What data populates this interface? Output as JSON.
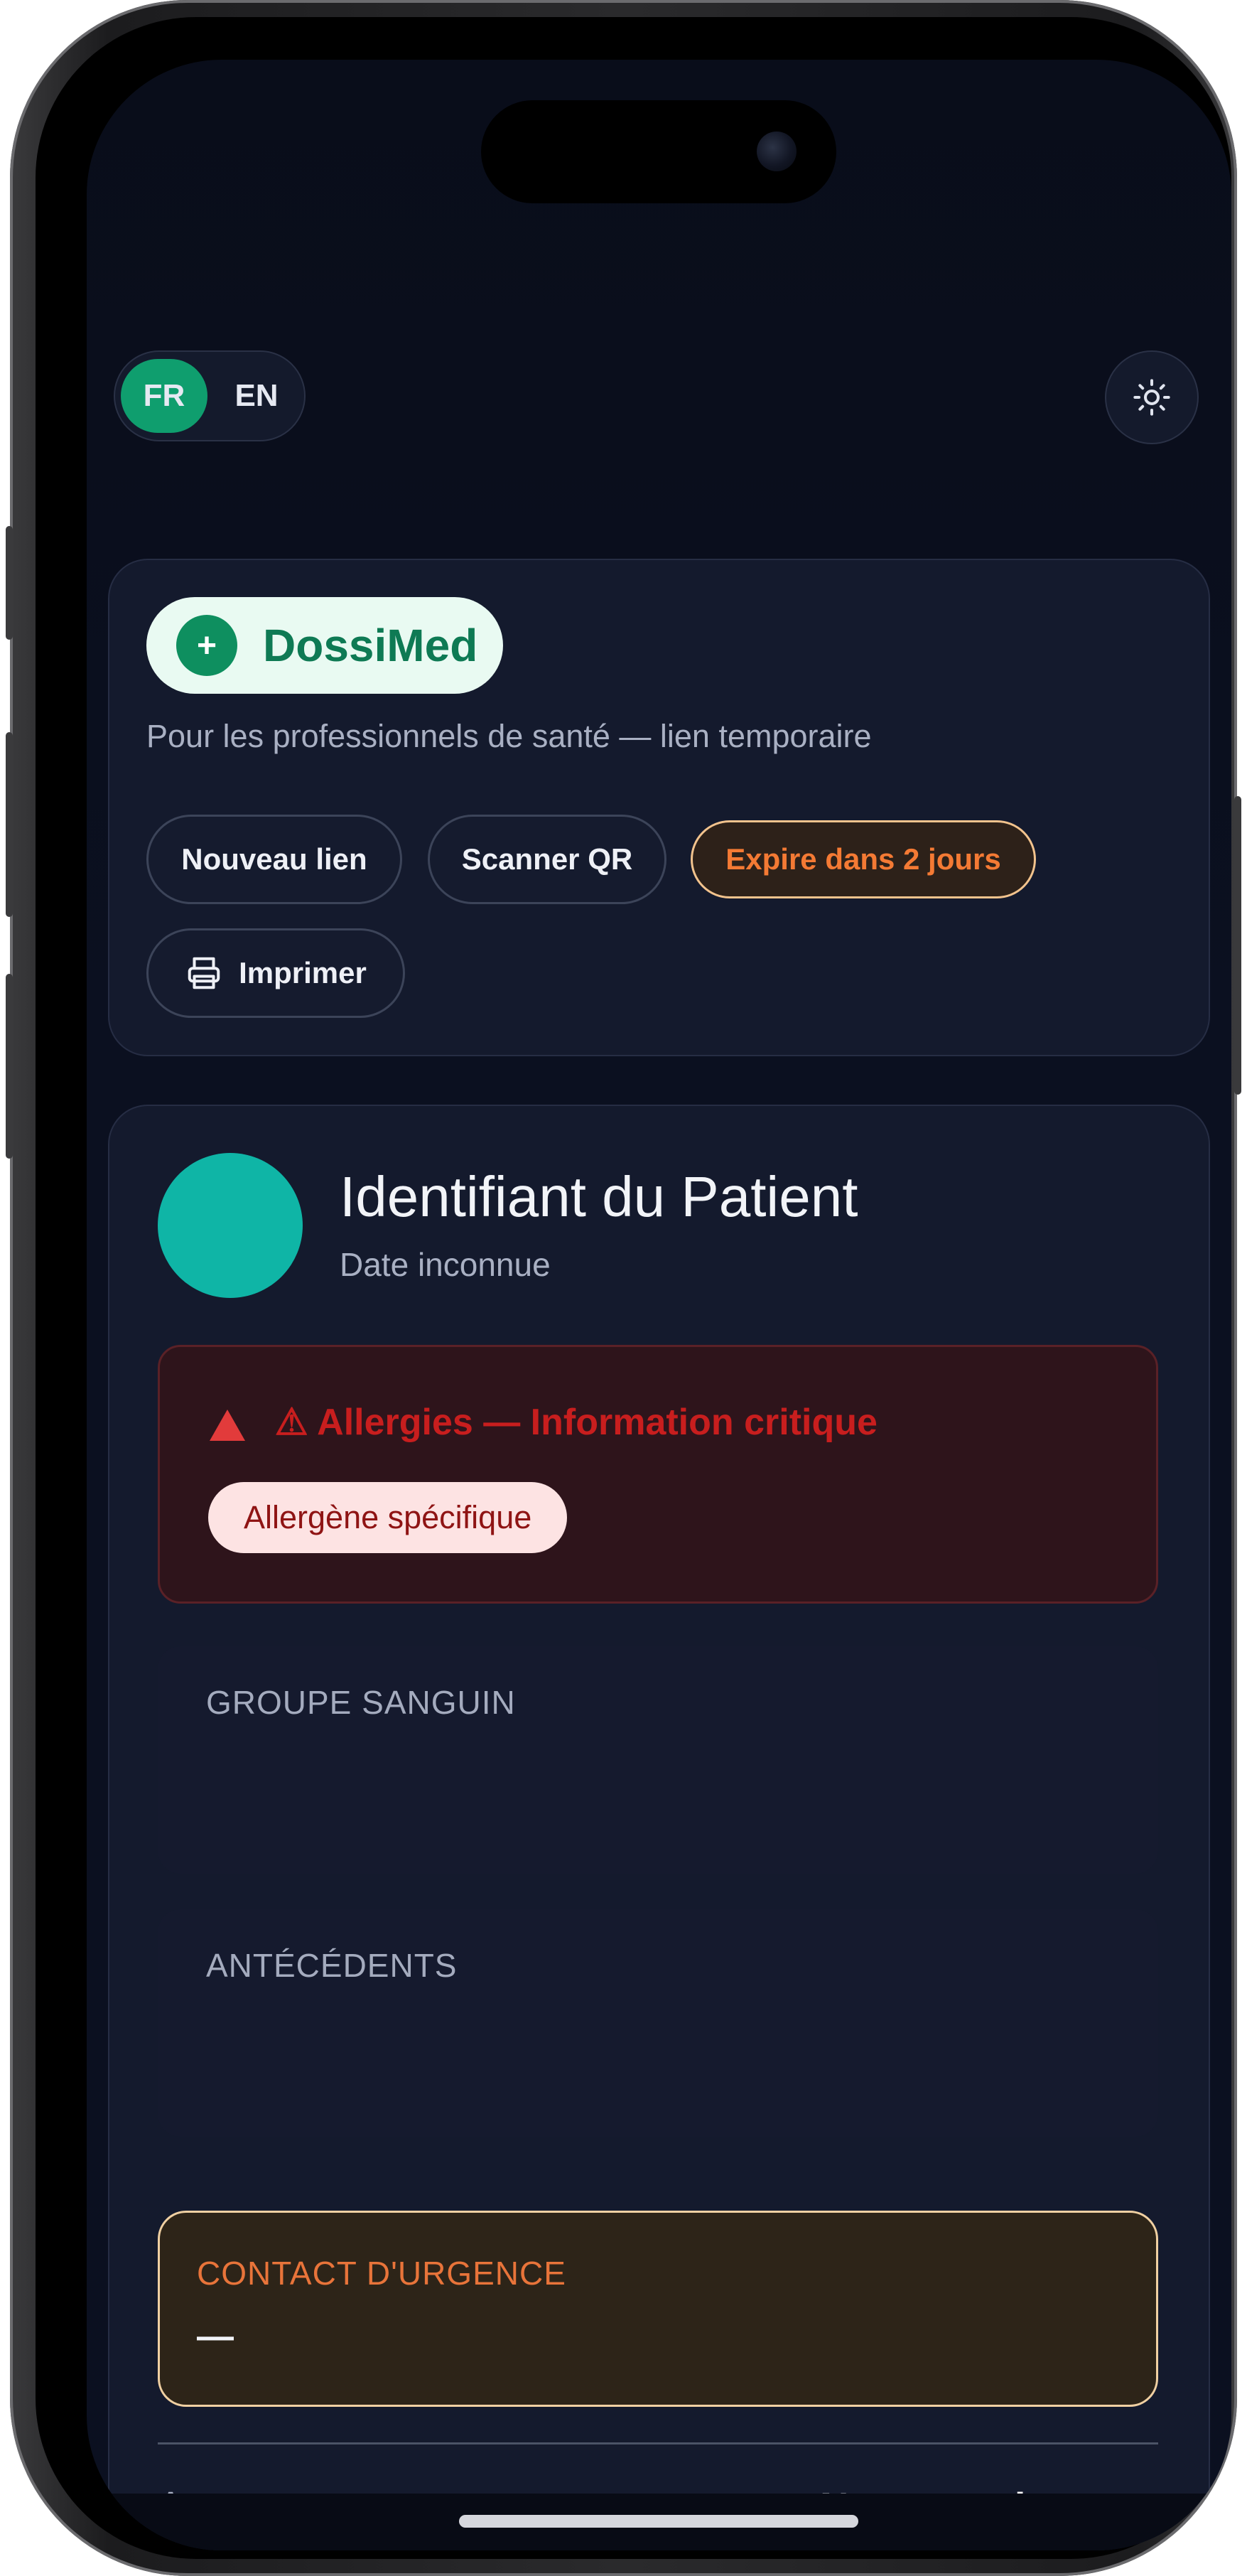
{
  "lang": {
    "fr": "FR",
    "en": "EN",
    "active": "FR"
  },
  "header": {
    "theme_icon": "sun-icon"
  },
  "brand": {
    "name": "DossiMed",
    "icon": "plus-icon",
    "subtitle": "Pour les professionnels de santé — lien temporaire"
  },
  "actions": {
    "new_link": "Nouveau lien",
    "scan_qr": "Scanner QR",
    "expiry": "Expire dans 2 jours",
    "print": "Imprimer",
    "print_icon": "printer-icon"
  },
  "patient": {
    "name": "Identifiant du Patient",
    "date": "Date inconnue",
    "avatar_color": "#0fb5a6"
  },
  "allergy": {
    "title": "⚠ Allergies — Information critique",
    "items": [
      "Allergène spécifique"
    ]
  },
  "sections": {
    "blood_group": "GROUPE SANGUIN",
    "history": "ANTÉCÉDENTS",
    "emergency_label": "CONTACT D'URGENCE",
    "emergency_value": "—"
  },
  "insurance": {
    "label": "Assurance",
    "value": "Non renseig"
  },
  "colors": {
    "accent": "#0f9e6e",
    "danger": "#c81e1e",
    "warning": "#e8743a",
    "background": "#0b1020"
  }
}
